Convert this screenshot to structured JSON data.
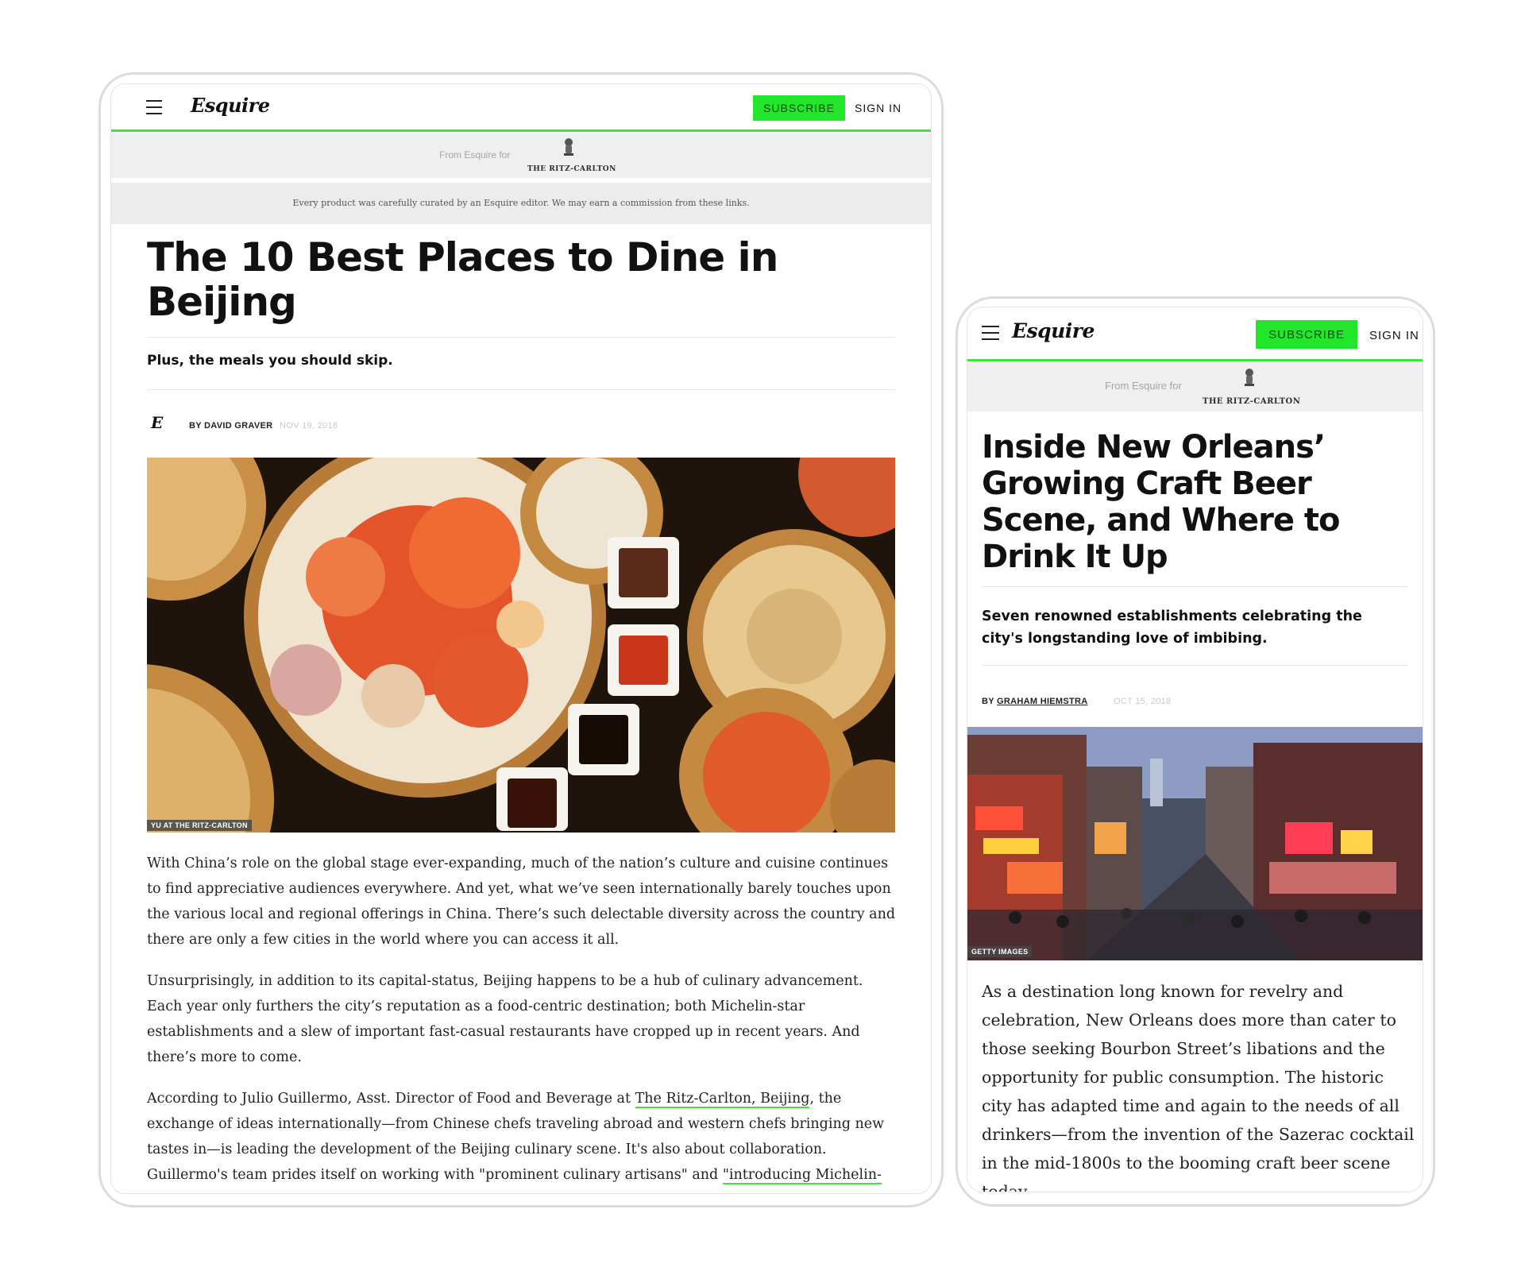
{
  "brand": {
    "logo_text": "Esquire",
    "accent_color": "#21e62a",
    "nav_line_color": "#3de53c"
  },
  "tablet": {
    "header": {
      "menu_icon": "hamburger-icon",
      "subscribe_label": "SUBSCRIBE",
      "signin_label": "SIGN IN"
    },
    "sponsor": {
      "from_label": "From Esquire for",
      "partner_name": "THE RITZ-CARLTON",
      "partner_icon": "lion-crest-icon"
    },
    "disclaimer": "Every product was carefully curated by an Esquire editor. We may earn a commission from these links.",
    "article": {
      "headline_line1": "The 10 Best Places to Dine in",
      "headline_line2": "Beijing",
      "dek": "Plus, the meals you should skip.",
      "author_badge": "E",
      "byline": "BY DAVID GRAVER",
      "date": "NOV 19, 2018",
      "image_credit": "YU AT THE RITZ-CARLTON",
      "paragraphs": [
        "With China’s role on the global stage ever-expanding, much of the nation’s culture and cuisine continues to find appreciative audiences everywhere. And yet, what we’ve seen internationally barely touches upon the various local and regional offerings in China. There’s such delectable diversity across the country and there are only a few cities in the world where you can access it all.",
        "Unsurprisingly, in addition to its capital-status, Beijing happens to be a hub of culinary advancement. Each year only furthers the city’s reputation as a food-centric destination; both Michelin-star establishments and a slew of important fast-casual restaurants have cropped up in recent years. And there’s more to come."
      ],
      "p3_part1": "According to Julio Guillermo, Asst. Director of Food and Beverage at ",
      "p3_link1": "The Ritz-Carlton, Beijing",
      "p3_part2": ", the exchange of ideas internationally—from Chinese chefs traveling abroad and western chefs bringing new tastes in—is leading the development of the Beijing culinary scene. It's also about collaboration. Guillermo's team prides itself on working with \"prominent culinary artisans\" and ",
      "p3_link2": "\"introducing Michelin-"
    }
  },
  "phone": {
    "header": {
      "menu_icon": "hamburger-icon",
      "subscribe_label": "SUBSCRIBE",
      "signin_label": "SIGN IN"
    },
    "sponsor": {
      "from_label": "From Esquire for",
      "partner_name": "THE RITZ-CARLTON",
      "partner_icon": "lion-crest-icon"
    },
    "article": {
      "headline_lines": [
        "Inside New Orleans’",
        "Growing Craft Beer",
        "Scene, and Where to",
        "Drink It Up"
      ],
      "dek": "Seven renowned establishments celebrating the city's longstanding love of imbibing.",
      "byline_prefix": "BY ",
      "author": "GRAHAM HIEMSTRA",
      "date": "OCT 15, 2018",
      "image_credit": "GETTY IMAGES",
      "paragraph": "As a destination long known for revelry and celebration, New Orleans does more than cater to those seeking Bourbon Street’s libations and the opportunity for public consumption. The historic city has adapted time and again to the needs of all drinkers—from the invention of the Sazerac cocktail in the mid-1800s to the booming craft beer scene today,"
    }
  }
}
